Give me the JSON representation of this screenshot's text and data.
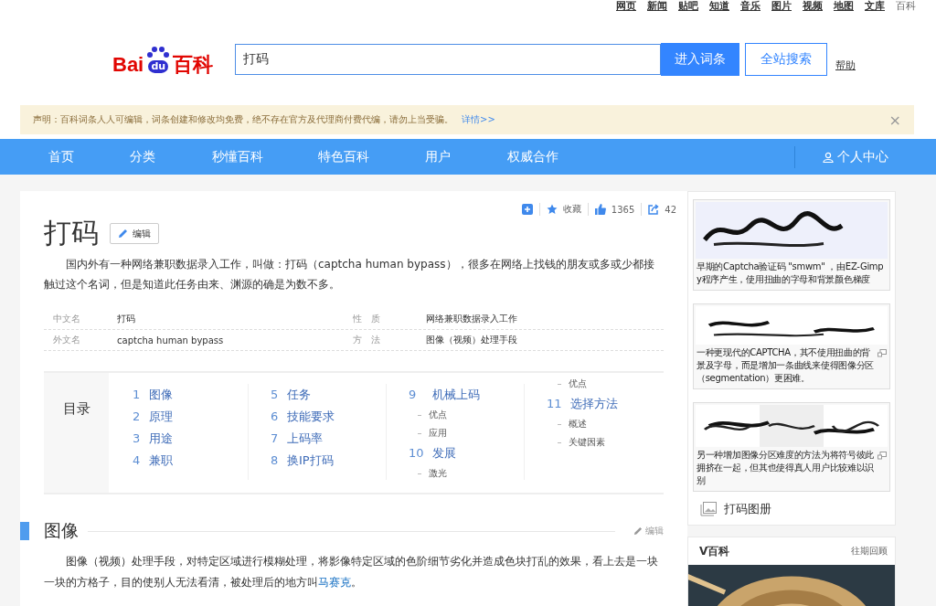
{
  "top_links": [
    "网页",
    "新闻",
    "贴吧",
    "知道",
    "音乐",
    "图片",
    "视频",
    "地图",
    "文库",
    "百科"
  ],
  "logo": {
    "part1": "Bai",
    "part2": "du",
    "part3": "百科"
  },
  "search": {
    "value": "打码",
    "primary_button": "进入词条",
    "secondary_button": "全站搜索",
    "help": "帮助"
  },
  "notice": {
    "text": "声明：百科词条人人可编辑，词条创建和修改均免费，绝不存在官方及代理商付费代编，请勿上当受骗。",
    "link": "详情>>",
    "close": "×"
  },
  "nav": {
    "items": [
      "首页",
      "分类",
      "秒懂百科",
      "特色百科",
      "用户",
      "权威合作"
    ],
    "user": "个人中心"
  },
  "toolbar": {
    "favorite": "收藏",
    "likes": "1365",
    "shares": "42"
  },
  "title": "打码",
  "edit_button": "编辑",
  "summary": "国内外有一种网络兼职数据录入工作，叫做：打码（captcha human bypass），很多在网络上找钱的朋友或多或少都接触过这个名词，但是知道此任务由来、渊源的确是为数不多。",
  "basic_info": [
    {
      "label": "中文名",
      "value": "打码",
      "label_2": "性　质",
      "value_2": "网络兼职数据录入工作"
    },
    {
      "label": "外文名",
      "value": "captcha human bypass",
      "label_2": "方　法",
      "value_2": "图像（视频）处理手段"
    }
  ],
  "toc": {
    "label": "目录",
    "columns": [
      [
        {
          "kind": "item",
          "number": "1",
          "title": "图像"
        },
        {
          "kind": "item",
          "number": "2",
          "title": "原理"
        },
        {
          "kind": "item",
          "number": "3",
          "title": "用途"
        },
        {
          "kind": "item",
          "number": "4",
          "title": "兼职"
        }
      ],
      [
        {
          "kind": "item",
          "number": "5",
          "title": "任务"
        },
        {
          "kind": "item",
          "number": "6",
          "title": "技能要求"
        },
        {
          "kind": "item",
          "number": "7",
          "title": "上码率"
        },
        {
          "kind": "item",
          "number": "8",
          "title": "换IP打码"
        }
      ],
      [
        {
          "kind": "item",
          "number": "9",
          "title": "机械上码"
        },
        {
          "kind": "sub",
          "title": "优点"
        },
        {
          "kind": "sub",
          "title": "应用"
        },
        {
          "kind": "item",
          "number": "10",
          "title": "发展"
        },
        {
          "kind": "sub",
          "title": "激光"
        }
      ],
      [
        {
          "kind": "sub",
          "title": "优点"
        },
        {
          "kind": "item",
          "number": "11",
          "title": "选择方法"
        },
        {
          "kind": "sub",
          "title": "概述"
        },
        {
          "kind": "sub",
          "title": "关键因素"
        }
      ]
    ]
  },
  "section": {
    "title": "图像",
    "edit": "编辑",
    "text_before": "图像（视频）处理手段，对特定区域进行模糊处理，将影像特定区域的色阶细节劣化并造成色块打乱的效果，看上去是一块一块的方格子，目的使别人无法看清，被处理后的地方叫",
    "link": "马赛克",
    "text_after": "。"
  },
  "figures": [
    {
      "kind": "picture",
      "caption": "早期的Captcha验证码 \"smwm\" ，由EZ-Gimpy程序产生，使用扭曲的字母和背景颜色梯度",
      "enlarge_icon": false
    },
    {
      "kind": "picture",
      "caption": "一种更现代的CAPTCHA，其不使用扭曲的背景及字母，而是增加一条曲线来使得图像分区（segmentation）更困难。",
      "enlarge_icon": true
    },
    {
      "kind": "picture",
      "caption": "另一种增加图像分区难度的方法为将符号彼此拥挤在一起，但其也使得真人用户比较难以识别",
      "enlarge_icon": true
    }
  ],
  "album": "打码图册",
  "vbaike": {
    "title": "V百科",
    "more": "往期回顾"
  }
}
